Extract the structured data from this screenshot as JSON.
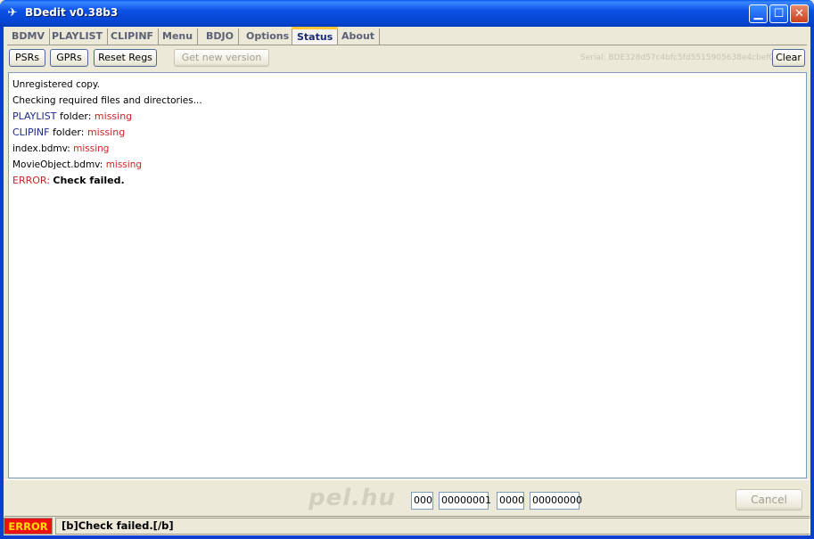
{
  "window": {
    "title": "BDedit v0.38b3",
    "icon": "bdedit-app-icon"
  },
  "tabs": [
    {
      "label": "BDMV",
      "active": false
    },
    {
      "label": "PLAYLIST",
      "active": false
    },
    {
      "label": "CLIPINF",
      "active": false
    },
    {
      "label": "Menu",
      "active": false
    },
    {
      "label": "BDJO",
      "active": false
    },
    {
      "label": "Options",
      "active": false
    },
    {
      "label": "Status",
      "active": true
    },
    {
      "label": "About",
      "active": false
    }
  ],
  "toolbar": {
    "psrs_label": "PSRs",
    "gprs_label": "GPRs",
    "reset_regs_label": "Reset Regs",
    "get_new_version_label": "Get new version",
    "clear_label": "Clear",
    "serial_text": "Serial: BDE328d57c4bfc5fd5515905638e4cbef0d"
  },
  "log": {
    "line1": "Unregistered copy.",
    "line2": "Checking required files and directories...",
    "line3_name": "PLAYLIST",
    "line3_mid": " folder: ",
    "line3_status": "missing",
    "line4_name": "CLIPINF",
    "line4_mid": " folder: ",
    "line4_status": "missing",
    "line5_name": "index.bdmv: ",
    "line5_status": "missing",
    "line6_name": "MovieObject.bdmv: ",
    "line6_status": "missing",
    "line7_prefix": "ERROR: ",
    "line7_msg": "Check failed."
  },
  "bottom": {
    "logo": "pel.hu",
    "field1": "000",
    "field2": "00000001",
    "field3": "0000",
    "field4": "00000000",
    "cancel_label": "Cancel"
  },
  "status": {
    "badge": "ERROR",
    "message": "[b]Check failed.[/b]"
  },
  "colors": {
    "titlebar": "#0a4fe4",
    "error_red": "#cc2424",
    "link_navy": "#1c2a8c",
    "badge_bg": "#ee1111",
    "badge_text": "#ffe000"
  }
}
